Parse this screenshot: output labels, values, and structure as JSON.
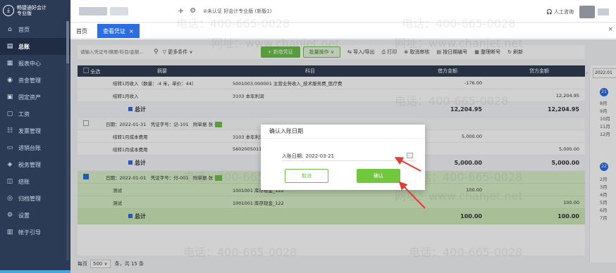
{
  "app": {
    "logo_line1": "畅捷通好会计",
    "logo_line2": "专业版",
    "company": "⊘未认证 好会计专业版 (新版1)",
    "service": "人工咨询"
  },
  "sidebar": {
    "items": [
      {
        "label": "首页",
        "icon": "home-icon"
      },
      {
        "label": "总账",
        "icon": "ledger-icon"
      },
      {
        "label": "报表中心",
        "icon": "report-icon"
      },
      {
        "label": "资金管理",
        "icon": "fund-icon"
      },
      {
        "label": "固定资产",
        "icon": "asset-icon"
      },
      {
        "label": "工资",
        "icon": "salary-icon"
      },
      {
        "label": "发票管理",
        "icon": "invoice-icon"
      },
      {
        "label": "进销台账",
        "icon": "inventory-icon"
      },
      {
        "label": "税务管理",
        "icon": "tax-icon"
      },
      {
        "label": "结账",
        "icon": "close-book-icon"
      },
      {
        "label": "归档管理",
        "icon": "archive-icon"
      },
      {
        "label": "设置",
        "icon": "settings-icon"
      },
      {
        "label": "帐于引导",
        "icon": "guide-icon"
      }
    ]
  },
  "tabs": [
    {
      "label": "首页"
    },
    {
      "label": "查看凭证",
      "close": "×"
    }
  ],
  "toolbar": {
    "search_placeholder": "请输入凭证号/摘要/科目/金额...",
    "more_filter": "更多条件 ∨",
    "new_voucher": "+ 新增凭证",
    "batch_ops": "批量操作 ∨",
    "import_export": "导入/导出",
    "print": "打印",
    "cancel_review": "取消审核",
    "sort": "按日期编号",
    "renumber": "整理断号",
    "refresh": "刷新"
  },
  "table": {
    "headers": [
      "全选",
      "摘要",
      "科目",
      "借方金额",
      "贷方金额"
    ],
    "group1": {
      "rows": [
        {
          "abstract": "结转1月收入（数量：-4 米，单价：44）",
          "subject": "5001003.000001 主营业务收入_技术服务费_医疗费",
          "debit": "-176.00",
          "credit": ""
        },
        {
          "abstract": "结转1月收入",
          "subject": "3103 本年利润",
          "debit": "",
          "credit": "12,204.95"
        }
      ],
      "total_label": "总计",
      "total_debit": "12,204.95",
      "total_credit": "12,204.95"
    },
    "group2": {
      "header": "日期：2022-01-31　凭证字号：记-101　附单据 张",
      "rows": [
        {
          "abstract": "结转1月成本费用",
          "subject": "3103 本年利润",
          "debit": "5,000.00",
          "credit": ""
        },
        {
          "abstract": "结转1月成本费用",
          "subject": "5602005011",
          "debit": "",
          "credit": "5,000.00"
        }
      ],
      "total_label": "总计",
      "total_debit": "5,000.00",
      "total_credit": "5,000.00"
    },
    "group3": {
      "header": "日期：2022-01-01　凭证字号：付-001　附单据 张",
      "rows": [
        {
          "abstract": "测试",
          "subject": "1001001 库存现金_122",
          "debit": "100.00",
          "credit": ""
        },
        {
          "abstract": "测试",
          "subject": "1001001 库存现金_122",
          "debit": "",
          "credit": "100.00"
        }
      ],
      "total_label": "总计",
      "total_debit": "100.00",
      "total_credit": "100.00"
    }
  },
  "date_panel": {
    "date_value": "2022.01",
    "year_top": "21",
    "year_bottom": "22",
    "months_top": [
      "8月",
      "9月",
      "10月",
      "11月",
      "12月"
    ],
    "months_bottom": [
      "2月",
      "3月",
      "4月",
      "5月",
      "6月",
      "7月"
    ]
  },
  "pager": {
    "prefix": "每页",
    "page_size": "500",
    "info": "条，共 15 条"
  },
  "dialog": {
    "title": "确认入账日期",
    "label": "入账日期:",
    "value": "2022-03-21",
    "cancel": "取消",
    "confirm": "确认"
  },
  "watermark": "电话：400-665-0028",
  "watermark2": "网址：www.chanjet.net",
  "colors": {
    "sidebar": "#2b3a55",
    "accent_blue": "#2c6de0",
    "accent_green": "#6cc04a",
    "arrow_red": "#e53935"
  }
}
